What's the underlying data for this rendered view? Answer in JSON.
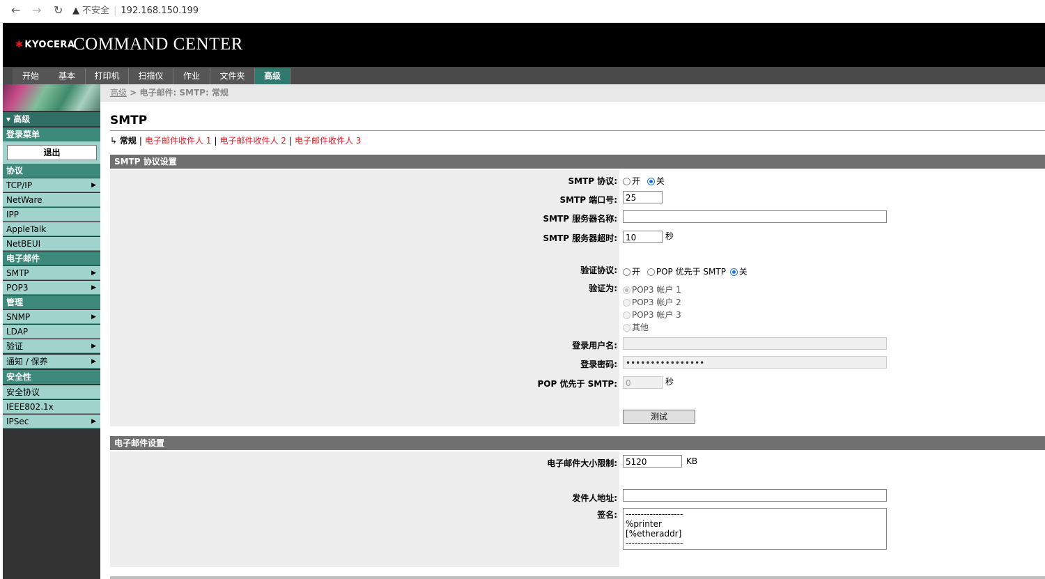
{
  "browser": {
    "insecure_label": "不安全",
    "url": "192.168.150.199"
  },
  "header": {
    "logo": "KYOCERA",
    "app_title": "COMMAND CENTER"
  },
  "tabs": [
    "开始",
    "基本",
    "打印机",
    "扫描仪",
    "作业",
    "文件夹",
    "高级"
  ],
  "active_tab": "高级",
  "sidebar": {
    "top_section": "▾ 高级",
    "login_menu": "登录菜单",
    "logout_button": "退出",
    "groups": [
      {
        "title": "协议",
        "items": [
          {
            "label": "TCP/IP",
            "arrow": true
          },
          {
            "label": "NetWare",
            "arrow": false
          },
          {
            "label": "IPP",
            "arrow": false
          },
          {
            "label": "AppleTalk",
            "arrow": false
          },
          {
            "label": "NetBEUI",
            "arrow": false
          }
        ]
      },
      {
        "title": "电子邮件",
        "items": [
          {
            "label": "SMTP",
            "arrow": true
          },
          {
            "label": "POP3",
            "arrow": true
          }
        ]
      },
      {
        "title": "管理",
        "items": [
          {
            "label": "SNMP",
            "arrow": true
          },
          {
            "label": "LDAP",
            "arrow": false
          },
          {
            "label": "验证",
            "arrow": true
          },
          {
            "label": "通知 / 保养",
            "arrow": true
          }
        ]
      },
      {
        "title": "安全性",
        "items": [
          {
            "label": "安全协议",
            "arrow": false
          },
          {
            "label": "IEEE802.1x",
            "arrow": false
          },
          {
            "label": "IPSec",
            "arrow": true
          }
        ]
      }
    ]
  },
  "breadcrumb": {
    "root": "高级",
    "sep": " > ",
    "current": "电子邮件: SMTP: 常规"
  },
  "page_title": "SMTP",
  "subnav": {
    "arrow": "↳",
    "current": "常规",
    "links": [
      "电子邮件收件人 1",
      "电子邮件收件人 2",
      "电子邮件收件人 3"
    ]
  },
  "smtp_section": {
    "title": "SMTP 协议设置",
    "protocol_label": "SMTP 协议:",
    "on_label": "开",
    "off_label": "关",
    "port_label": "SMTP 端口号:",
    "port_value": "25",
    "server_label": "SMTP 服务器名称:",
    "server_value": "",
    "timeout_label": "SMTP 服务器超时:",
    "timeout_value": "10",
    "seconds": "秒",
    "auth_label": "验证协议:",
    "auth_on": "开",
    "auth_pop": "POP 优先于 SMTP",
    "auth_off": "关",
    "auth_as_label": "验证为:",
    "auth_as_options": [
      "POP3 帐户 1",
      "POP3 帐户 2",
      "POP3 帐户 3",
      "其他"
    ],
    "username_label": "登录用户名:",
    "username_value": "",
    "password_label": "登录密码:",
    "password_value": "••••••••••••••••",
    "pop_before_label": "POP 优先于 SMTP:",
    "pop_before_value": "0",
    "test_button": "测试"
  },
  "email_section": {
    "title": "电子邮件设置",
    "size_label": "电子邮件大小限制:",
    "size_value": "5120",
    "size_unit": "KB",
    "sender_label": "发件人地址:",
    "sender_value": "",
    "signature_label": "签名:",
    "signature_value": "-------------------\n%printer\n[%etheraddr]\n-------------------"
  }
}
